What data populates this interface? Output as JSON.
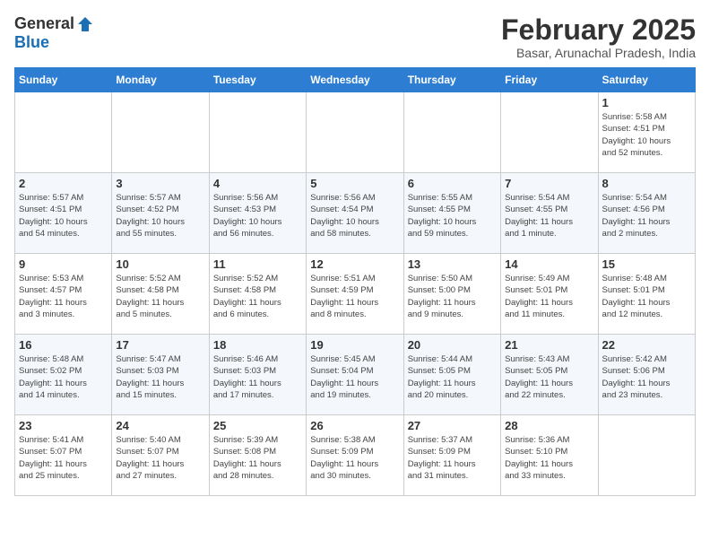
{
  "header": {
    "logo_general": "General",
    "logo_blue": "Blue",
    "title": "February 2025",
    "subtitle": "Basar, Arunachal Pradesh, India"
  },
  "weekdays": [
    "Sunday",
    "Monday",
    "Tuesday",
    "Wednesday",
    "Thursday",
    "Friday",
    "Saturday"
  ],
  "weeks": [
    [
      {
        "day": "",
        "info": ""
      },
      {
        "day": "",
        "info": ""
      },
      {
        "day": "",
        "info": ""
      },
      {
        "day": "",
        "info": ""
      },
      {
        "day": "",
        "info": ""
      },
      {
        "day": "",
        "info": ""
      },
      {
        "day": "1",
        "info": "Sunrise: 5:58 AM\nSunset: 4:51 PM\nDaylight: 10 hours\nand 52 minutes."
      }
    ],
    [
      {
        "day": "2",
        "info": "Sunrise: 5:57 AM\nSunset: 4:51 PM\nDaylight: 10 hours\nand 54 minutes."
      },
      {
        "day": "3",
        "info": "Sunrise: 5:57 AM\nSunset: 4:52 PM\nDaylight: 10 hours\nand 55 minutes."
      },
      {
        "day": "4",
        "info": "Sunrise: 5:56 AM\nSunset: 4:53 PM\nDaylight: 10 hours\nand 56 minutes."
      },
      {
        "day": "5",
        "info": "Sunrise: 5:56 AM\nSunset: 4:54 PM\nDaylight: 10 hours\nand 58 minutes."
      },
      {
        "day": "6",
        "info": "Sunrise: 5:55 AM\nSunset: 4:55 PM\nDaylight: 10 hours\nand 59 minutes."
      },
      {
        "day": "7",
        "info": "Sunrise: 5:54 AM\nSunset: 4:55 PM\nDaylight: 11 hours\nand 1 minute."
      },
      {
        "day": "8",
        "info": "Sunrise: 5:54 AM\nSunset: 4:56 PM\nDaylight: 11 hours\nand 2 minutes."
      }
    ],
    [
      {
        "day": "9",
        "info": "Sunrise: 5:53 AM\nSunset: 4:57 PM\nDaylight: 11 hours\nand 3 minutes."
      },
      {
        "day": "10",
        "info": "Sunrise: 5:52 AM\nSunset: 4:58 PM\nDaylight: 11 hours\nand 5 minutes."
      },
      {
        "day": "11",
        "info": "Sunrise: 5:52 AM\nSunset: 4:58 PM\nDaylight: 11 hours\nand 6 minutes."
      },
      {
        "day": "12",
        "info": "Sunrise: 5:51 AM\nSunset: 4:59 PM\nDaylight: 11 hours\nand 8 minutes."
      },
      {
        "day": "13",
        "info": "Sunrise: 5:50 AM\nSunset: 5:00 PM\nDaylight: 11 hours\nand 9 minutes."
      },
      {
        "day": "14",
        "info": "Sunrise: 5:49 AM\nSunset: 5:01 PM\nDaylight: 11 hours\nand 11 minutes."
      },
      {
        "day": "15",
        "info": "Sunrise: 5:48 AM\nSunset: 5:01 PM\nDaylight: 11 hours\nand 12 minutes."
      }
    ],
    [
      {
        "day": "16",
        "info": "Sunrise: 5:48 AM\nSunset: 5:02 PM\nDaylight: 11 hours\nand 14 minutes."
      },
      {
        "day": "17",
        "info": "Sunrise: 5:47 AM\nSunset: 5:03 PM\nDaylight: 11 hours\nand 15 minutes."
      },
      {
        "day": "18",
        "info": "Sunrise: 5:46 AM\nSunset: 5:03 PM\nDaylight: 11 hours\nand 17 minutes."
      },
      {
        "day": "19",
        "info": "Sunrise: 5:45 AM\nSunset: 5:04 PM\nDaylight: 11 hours\nand 19 minutes."
      },
      {
        "day": "20",
        "info": "Sunrise: 5:44 AM\nSunset: 5:05 PM\nDaylight: 11 hours\nand 20 minutes."
      },
      {
        "day": "21",
        "info": "Sunrise: 5:43 AM\nSunset: 5:05 PM\nDaylight: 11 hours\nand 22 minutes."
      },
      {
        "day": "22",
        "info": "Sunrise: 5:42 AM\nSunset: 5:06 PM\nDaylight: 11 hours\nand 23 minutes."
      }
    ],
    [
      {
        "day": "23",
        "info": "Sunrise: 5:41 AM\nSunset: 5:07 PM\nDaylight: 11 hours\nand 25 minutes."
      },
      {
        "day": "24",
        "info": "Sunrise: 5:40 AM\nSunset: 5:07 PM\nDaylight: 11 hours\nand 27 minutes."
      },
      {
        "day": "25",
        "info": "Sunrise: 5:39 AM\nSunset: 5:08 PM\nDaylight: 11 hours\nand 28 minutes."
      },
      {
        "day": "26",
        "info": "Sunrise: 5:38 AM\nSunset: 5:09 PM\nDaylight: 11 hours\nand 30 minutes."
      },
      {
        "day": "27",
        "info": "Sunrise: 5:37 AM\nSunset: 5:09 PM\nDaylight: 11 hours\nand 31 minutes."
      },
      {
        "day": "28",
        "info": "Sunrise: 5:36 AM\nSunset: 5:10 PM\nDaylight: 11 hours\nand 33 minutes."
      },
      {
        "day": "",
        "info": ""
      }
    ]
  ]
}
